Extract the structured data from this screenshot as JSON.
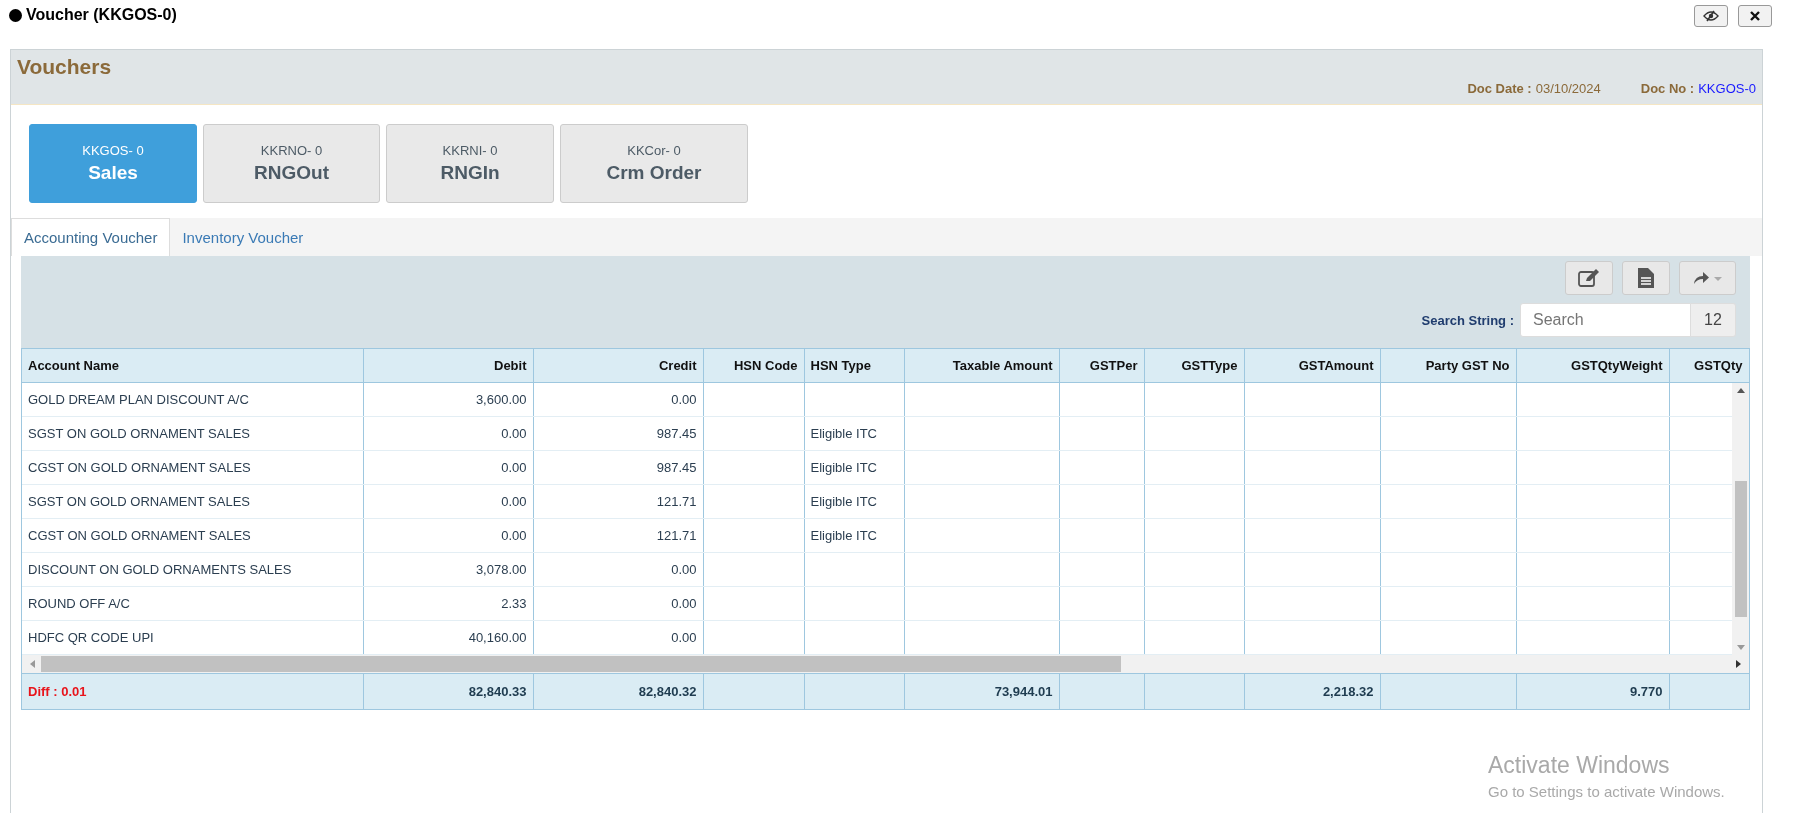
{
  "window": {
    "title": "Voucher (KKGOS-0)"
  },
  "panel": {
    "title": "Vouchers",
    "doc_date_label": "Doc Date :",
    "doc_date": "03/10/2024",
    "doc_no_label": "Doc No :",
    "doc_no": "KKGOS-0"
  },
  "voucher_types": [
    {
      "code": "KKGOS- 0",
      "name": "Sales",
      "selected": true
    },
    {
      "code": "KKRNO- 0",
      "name": "RNGOut",
      "selected": false
    },
    {
      "code": "KKRNI- 0",
      "name": "RNGIn",
      "selected": false
    },
    {
      "code": "KKCor- 0",
      "name": "Crm Order",
      "selected": false
    }
  ],
  "tabs": [
    {
      "label": "Accounting Voucher",
      "selected": true
    },
    {
      "label": "Inventory Voucher",
      "selected": false
    }
  ],
  "search": {
    "label": "Search String :",
    "placeholder": "Search",
    "count": "12"
  },
  "table": {
    "columns": [
      "Account Name",
      "Debit",
      "Credit",
      "HSN Code",
      "HSN Type",
      "Taxable Amount",
      "GSTPer",
      "GSTType",
      "GSTAmount",
      "Party GST No",
      "GSTQtyWeight",
      "GSTQty"
    ],
    "rows": [
      {
        "account_name": "GOLD DREAM PLAN DISCOUNT A/C",
        "debit": "3,600.00",
        "credit": "0.00"
      },
      {
        "account_name": "SGST ON GOLD ORNAMENT SALES",
        "debit": "0.00",
        "credit": "987.45",
        "hsn_type": "Eligible ITC"
      },
      {
        "account_name": "CGST ON GOLD ORNAMENT SALES",
        "debit": "0.00",
        "credit": "987.45",
        "hsn_type": "Eligible ITC"
      },
      {
        "account_name": "SGST ON GOLD ORNAMENT SALES",
        "debit": "0.00",
        "credit": "121.71",
        "hsn_type": "Eligible ITC"
      },
      {
        "account_name": "CGST ON GOLD ORNAMENT SALES",
        "debit": "0.00",
        "credit": "121.71",
        "hsn_type": "Eligible ITC"
      },
      {
        "account_name": "DISCOUNT ON GOLD ORNAMENTS SALES",
        "debit": "3,078.00",
        "credit": "0.00"
      },
      {
        "account_name": "ROUND OFF A/C",
        "debit": "2.33",
        "credit": "0.00"
      },
      {
        "account_name": "HDFC QR CODE UPI",
        "debit": "40,160.00",
        "credit": "0.00"
      }
    ],
    "footer": {
      "diff": "Diff : 0.01",
      "debit_total": "82,840.33",
      "credit_total": "82,840.32",
      "taxable_amount_total": "73,944.01",
      "gst_amount_total": "2,218.32",
      "gst_qty_weight_total": "9.770"
    }
  },
  "os_notice": {
    "title": "Activate Windows",
    "text": "Go to Settings to activate Windows."
  }
}
